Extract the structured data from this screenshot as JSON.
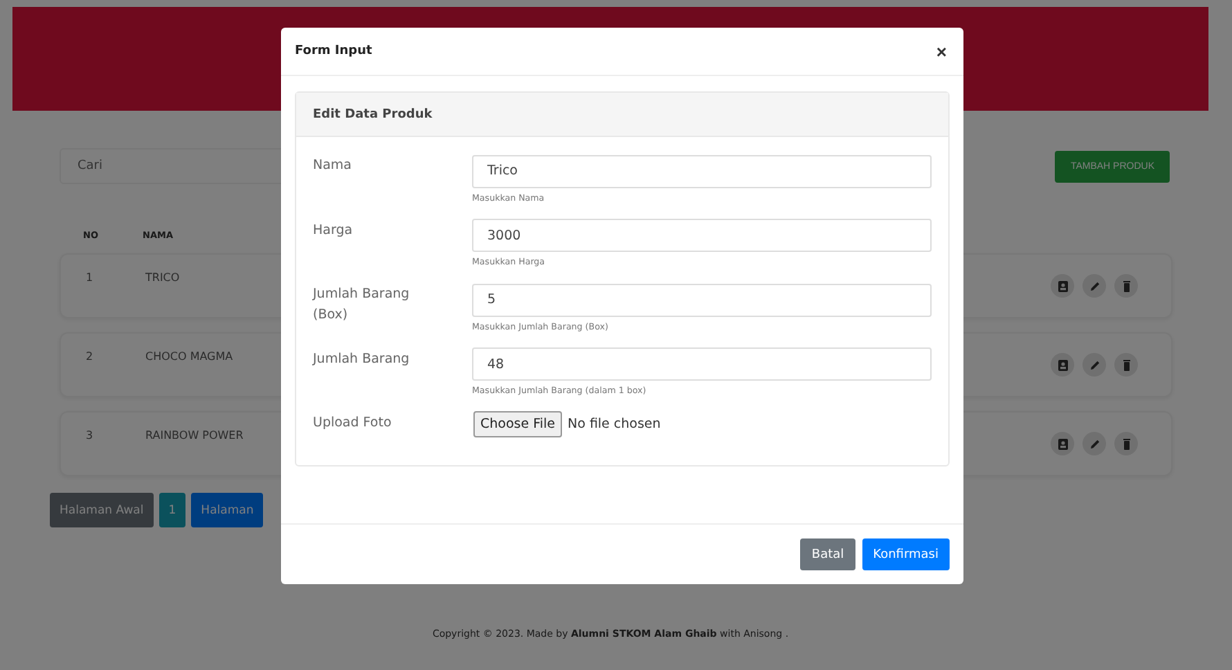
{
  "search": {
    "placeholder": "Cari"
  },
  "add_button": "TAMBAH PRODUK",
  "table": {
    "columns": [
      "NO",
      "NAMA"
    ],
    "rows": [
      {
        "no": "1",
        "nama": "TRICO"
      },
      {
        "no": "2",
        "nama": "CHOCO MAGMA"
      },
      {
        "no": "3",
        "nama": "RAINBOW POWER"
      }
    ]
  },
  "pagination": [
    {
      "label": "Halaman Awal",
      "kind": "first"
    },
    {
      "label": "1",
      "kind": "page"
    },
    {
      "label": "Halaman",
      "kind": "next"
    }
  ],
  "footer": "Copyright © 2023. Made by **Alumni STKOM Alam Ghaib** with Anisong .",
  "modal": {
    "title": "Form Input",
    "close": "×",
    "card_title": "Edit Data Produk",
    "fields": [
      {
        "kind": "text",
        "label": "Nama",
        "value": "Trico",
        "help": "Masukkan Nama"
      },
      {
        "kind": "text",
        "label": "Harga",
        "value": "3000",
        "help": "Masukkan Harga"
      },
      {
        "kind": "text",
        "label": "Jumlah Barang (Box)",
        "value": "5",
        "help": "Masukkan Jumlah Barang (Box)"
      },
      {
        "kind": "text",
        "label": "Jumlah Barang",
        "value": "48",
        "help": "Masukkan Jumlah Barang (dalam 1 box)"
      },
      {
        "kind": "file",
        "label": "Upload Foto",
        "button": "Choose File",
        "status": "No file chosen"
      }
    ],
    "buttons": [
      {
        "label": "Batal",
        "kind": "secondary"
      },
      {
        "label": "Konfirmasi",
        "kind": "primary"
      }
    ]
  }
}
